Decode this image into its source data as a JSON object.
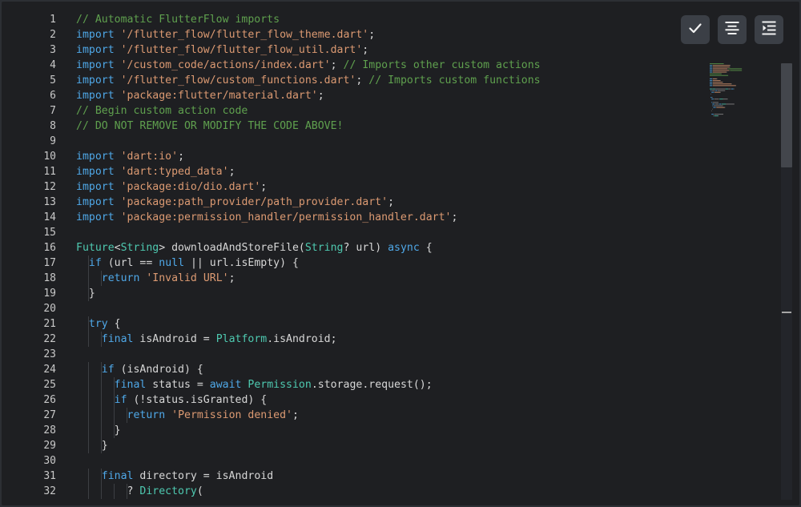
{
  "toolbar": {
    "buttons": [
      {
        "name": "check",
        "icon": "check-icon"
      },
      {
        "name": "format",
        "icon": "align-center-icon"
      },
      {
        "name": "indent",
        "icon": "indent-icon"
      }
    ]
  },
  "colors": {
    "background": "#1e1f22",
    "comment": "#5fa04e",
    "keyword": "#4fa8e8",
    "string": "#dc9a72",
    "type": "#4ec9b0",
    "text": "#d7d7d7"
  },
  "code": {
    "lines": [
      {
        "n": "1",
        "tokens": [
          [
            "c",
            "// Automatic FlutterFlow imports"
          ]
        ]
      },
      {
        "n": "2",
        "tokens": [
          [
            "k",
            "import"
          ],
          [
            "p",
            " "
          ],
          [
            "s",
            "'/flutter_flow/flutter_flow_theme.dart'"
          ],
          [
            "p",
            ";"
          ]
        ]
      },
      {
        "n": "3",
        "tokens": [
          [
            "k",
            "import"
          ],
          [
            "p",
            " "
          ],
          [
            "s",
            "'/flutter_flow/flutter_flow_util.dart'"
          ],
          [
            "p",
            ";"
          ]
        ]
      },
      {
        "n": "4",
        "tokens": [
          [
            "k",
            "import"
          ],
          [
            "p",
            " "
          ],
          [
            "s",
            "'/custom_code/actions/index.dart'"
          ],
          [
            "p",
            "; "
          ],
          [
            "c",
            "// Imports other custom actions"
          ]
        ]
      },
      {
        "n": "5",
        "tokens": [
          [
            "k",
            "import"
          ],
          [
            "p",
            " "
          ],
          [
            "s",
            "'/flutter_flow/custom_functions.dart'"
          ],
          [
            "p",
            "; "
          ],
          [
            "c",
            "// Imports custom functions"
          ]
        ]
      },
      {
        "n": "6",
        "tokens": [
          [
            "k",
            "import"
          ],
          [
            "p",
            " "
          ],
          [
            "s",
            "'package:flutter/material.dart'"
          ],
          [
            "p",
            ";"
          ]
        ]
      },
      {
        "n": "7",
        "tokens": [
          [
            "c",
            "// Begin custom action code"
          ]
        ]
      },
      {
        "n": "8",
        "tokens": [
          [
            "c",
            "// DO NOT REMOVE OR MODIFY THE CODE ABOVE!"
          ]
        ]
      },
      {
        "n": "9",
        "tokens": []
      },
      {
        "n": "10",
        "tokens": [
          [
            "k",
            "import"
          ],
          [
            "p",
            " "
          ],
          [
            "s",
            "'dart:io'"
          ],
          [
            "p",
            ";"
          ]
        ]
      },
      {
        "n": "11",
        "tokens": [
          [
            "k",
            "import"
          ],
          [
            "p",
            " "
          ],
          [
            "s",
            "'dart:typed_data'"
          ],
          [
            "p",
            ";"
          ]
        ]
      },
      {
        "n": "12",
        "tokens": [
          [
            "k",
            "import"
          ],
          [
            "p",
            " "
          ],
          [
            "s",
            "'package:dio/dio.dart'"
          ],
          [
            "p",
            ";"
          ]
        ]
      },
      {
        "n": "13",
        "tokens": [
          [
            "k",
            "import"
          ],
          [
            "p",
            " "
          ],
          [
            "s",
            "'package:path_provider/path_provider.dart'"
          ],
          [
            "p",
            ";"
          ]
        ]
      },
      {
        "n": "14",
        "tokens": [
          [
            "k",
            "import"
          ],
          [
            "p",
            " "
          ],
          [
            "s",
            "'package:permission_handler/permission_handler.dart'"
          ],
          [
            "p",
            ";"
          ]
        ]
      },
      {
        "n": "15",
        "tokens": []
      },
      {
        "n": "16",
        "tokens": [
          [
            "t",
            "Future"
          ],
          [
            "p",
            "<"
          ],
          [
            "t",
            "String"
          ],
          [
            "p",
            "> downloadAndStoreFile("
          ],
          [
            "t",
            "String"
          ],
          [
            "p",
            "? url) "
          ],
          [
            "k",
            "async"
          ],
          [
            "p",
            " {"
          ]
        ]
      },
      {
        "n": "17",
        "tokens": [
          [
            "p",
            "  "
          ],
          [
            "k",
            "if"
          ],
          [
            "p",
            " (url == "
          ],
          [
            "k",
            "null"
          ],
          [
            "p",
            " || url.isEmpty) {"
          ]
        ]
      },
      {
        "n": "18",
        "tokens": [
          [
            "p",
            "    "
          ],
          [
            "k",
            "return"
          ],
          [
            "p",
            " "
          ],
          [
            "s",
            "'Invalid URL'"
          ],
          [
            "p",
            ";"
          ]
        ]
      },
      {
        "n": "19",
        "tokens": [
          [
            "p",
            "  }"
          ]
        ]
      },
      {
        "n": "20",
        "tokens": []
      },
      {
        "n": "21",
        "tokens": [
          [
            "p",
            "  "
          ],
          [
            "k",
            "try"
          ],
          [
            "p",
            " {"
          ]
        ]
      },
      {
        "n": "22",
        "tokens": [
          [
            "p",
            "    "
          ],
          [
            "k",
            "final"
          ],
          [
            "p",
            " isAndroid = "
          ],
          [
            "t",
            "Platform"
          ],
          [
            "p",
            ".isAndroid;"
          ]
        ]
      },
      {
        "n": "23",
        "tokens": []
      },
      {
        "n": "24",
        "tokens": [
          [
            "p",
            "    "
          ],
          [
            "k",
            "if"
          ],
          [
            "p",
            " (isAndroid) {"
          ]
        ]
      },
      {
        "n": "25",
        "tokens": [
          [
            "p",
            "      "
          ],
          [
            "k",
            "final"
          ],
          [
            "p",
            " status = "
          ],
          [
            "k",
            "await"
          ],
          [
            "p",
            " "
          ],
          [
            "t",
            "Permission"
          ],
          [
            "p",
            ".storage.request();"
          ]
        ]
      },
      {
        "n": "26",
        "tokens": [
          [
            "p",
            "      "
          ],
          [
            "k",
            "if"
          ],
          [
            "p",
            " (!status.isGranted) {"
          ]
        ]
      },
      {
        "n": "27",
        "tokens": [
          [
            "p",
            "        "
          ],
          [
            "k",
            "return"
          ],
          [
            "p",
            " "
          ],
          [
            "s",
            "'Permission denied'"
          ],
          [
            "p",
            ";"
          ]
        ]
      },
      {
        "n": "28",
        "tokens": [
          [
            "p",
            "      }"
          ]
        ]
      },
      {
        "n": "29",
        "tokens": [
          [
            "p",
            "    }"
          ]
        ]
      },
      {
        "n": "30",
        "tokens": []
      },
      {
        "n": "31",
        "tokens": [
          [
            "p",
            "    "
          ],
          [
            "k",
            "final"
          ],
          [
            "p",
            " directory = isAndroid"
          ]
        ]
      },
      {
        "n": "32",
        "tokens": [
          [
            "p",
            "        ? "
          ],
          [
            "t",
            "Directory"
          ],
          [
            "p",
            "("
          ]
        ]
      }
    ]
  }
}
